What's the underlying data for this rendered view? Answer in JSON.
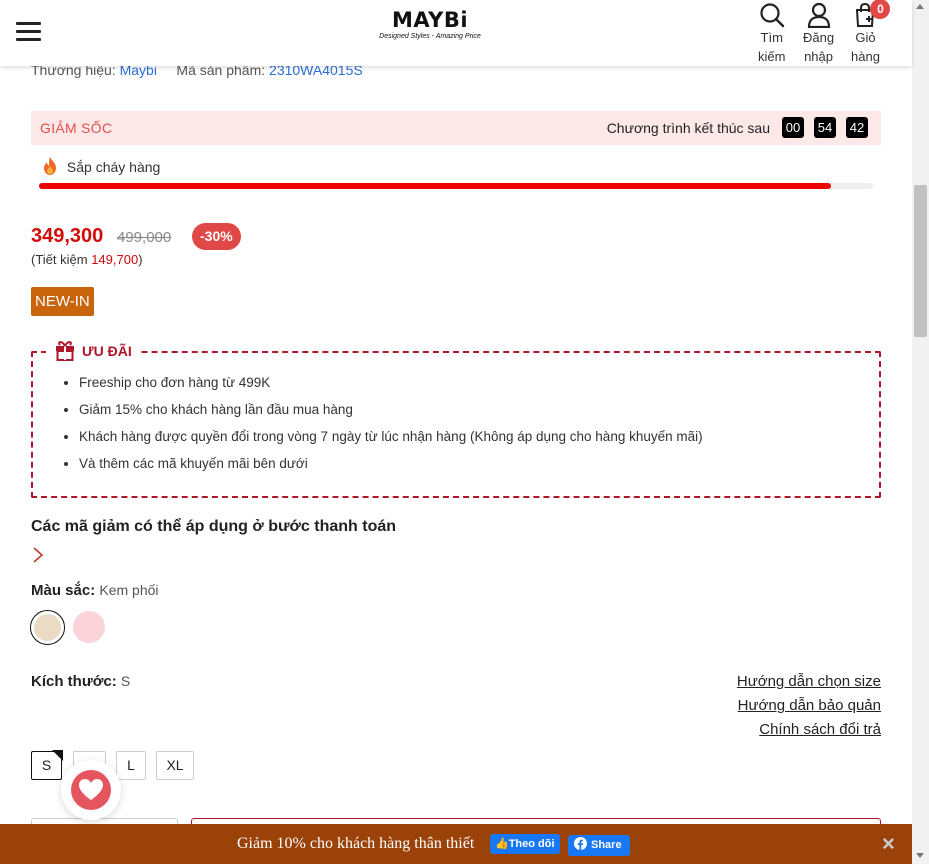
{
  "header": {
    "logo_brand": "MAYBi",
    "logo_tagline": "Designed Styles - Amazing Price",
    "search_label_1": "Tìm",
    "search_label_2": "kiếm",
    "login_label_1": "Đăng",
    "login_label_2": "nhập",
    "cart_label_1": "Giỏ",
    "cart_label_2": "hàng",
    "cart_count": "0"
  },
  "product_meta": {
    "brand_label": "Thương hiệu:",
    "brand_value": "Maybi",
    "sku_label": "Mã sản phẩm:",
    "sku_value": "2310WA4015S"
  },
  "flash_sale": {
    "title": "GIẢM SỐC",
    "ends_label": "Chương trình kết thúc sau",
    "hours": "00",
    "minutes": "54",
    "seconds": "42",
    "stock_label": "Sắp cháy hàng",
    "stock_progress": 0.95
  },
  "pricing": {
    "price": "349,300",
    "old_price": "499,000",
    "discount": "-30%",
    "saving_prefix": "(Tiết kiệm ",
    "saving_amount": "149,700",
    "saving_suffix": ")"
  },
  "badge": "NEW-IN",
  "promo": {
    "title": "ƯU ĐÃI",
    "items": [
      "Freeship cho đơn hàng từ 499K",
      "Giảm 15% cho khách hàng lần đầu mua hàng",
      "Khách hàng được quyền đổi trong vòng 7 ngày từ lúc nhận hàng (Không áp dụng cho hàng khuyến mãi)",
      "Và thêm các mã khuyến mãi bên dưới"
    ]
  },
  "codes_title": "Các mã giảm có thể áp dụng ở bước thanh toán",
  "color": {
    "label": "Màu sắc:",
    "value": "Kem phối",
    "swatches": [
      "#eadcc4",
      "#fbd3da"
    ]
  },
  "size": {
    "label": "Kích thước:",
    "value": "S",
    "options": [
      "S",
      "M",
      "L",
      "XL"
    ],
    "guide_links": [
      "Hướng dẫn chọn size",
      "Hướng dẫn bảo quản",
      "Chính sách đổi trả"
    ]
  },
  "footer": {
    "text": "Giảm 10% cho khách hàng thân thiết",
    "follow_label": "Theo dõi",
    "share_label": "Share",
    "close": "×"
  },
  "colors": {
    "accent_red": "#d20a0a",
    "badge_orange": "#c8640c",
    "footer_bg": "#9a4208",
    "facebook_blue": "#1877f2"
  }
}
